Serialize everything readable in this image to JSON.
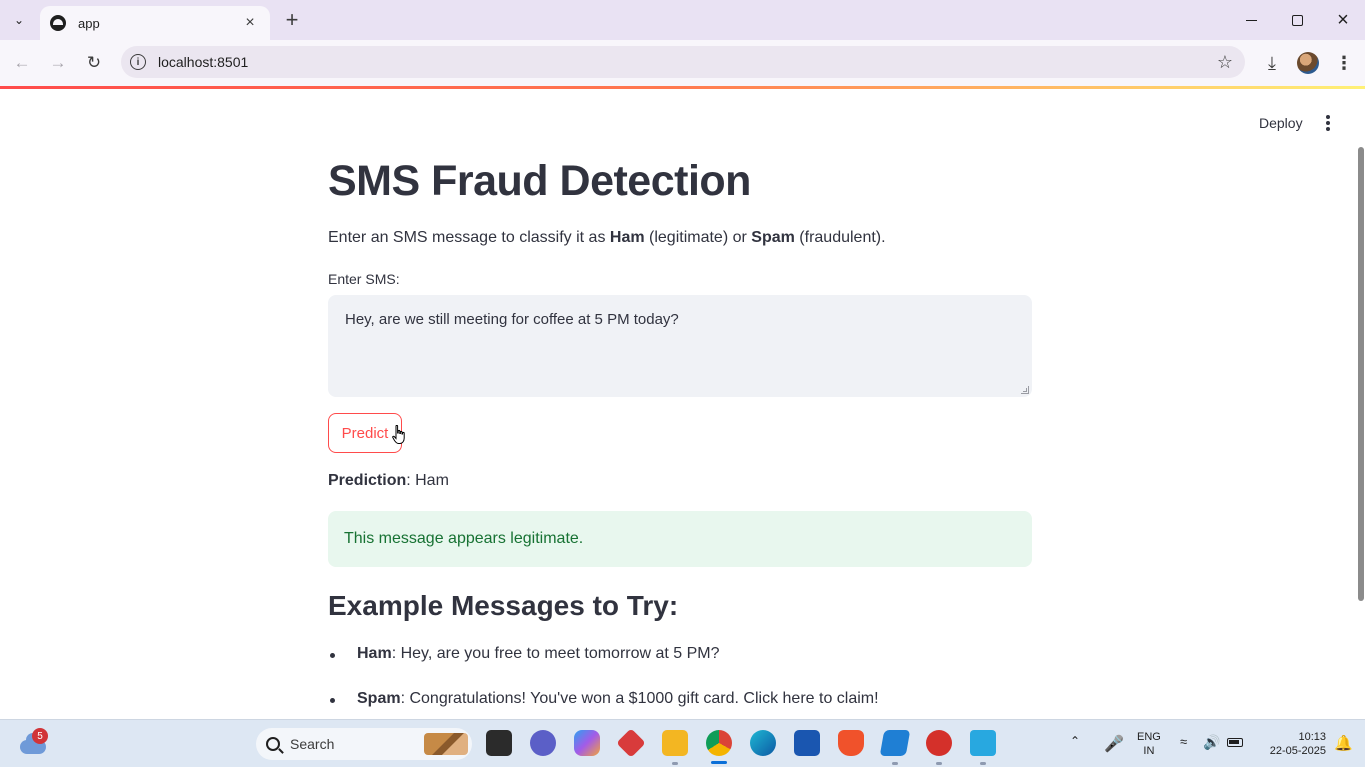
{
  "browser": {
    "tab_title": "app",
    "url": "localhost:8501"
  },
  "app": {
    "deploy_label": "Deploy",
    "title": "SMS Fraud Detection",
    "intro": {
      "part1": "Enter an SMS message to classify it as ",
      "ham": "Ham",
      "part2": " (legitimate) or ",
      "spam": "Spam",
      "part3": " (fraudulent)."
    },
    "input_label": "Enter SMS:",
    "input_value": "Hey, are we still meeting for coffee at 5 PM today?",
    "predict_label": "Predict",
    "prediction": {
      "label": "Prediction",
      "value": ": Ham"
    },
    "result_message": "This message appears legitimate.",
    "examples_heading": "Example Messages to Try:",
    "examples": [
      {
        "label": "Ham",
        "text": ": Hey, are you free to meet tomorrow at 5 PM?"
      },
      {
        "label": "Spam",
        "text": ": Congratulations! You've won a $1000 gift card. Click here to claim!"
      }
    ]
  },
  "taskbar": {
    "weather_badge": "5",
    "search_label": "Search",
    "lang_line1": "ENG",
    "lang_line2": "IN",
    "time": "10:13",
    "date": "22-05-2025"
  },
  "colors": {
    "accent": "#ff4b4b",
    "success_bg": "#e8f7ee",
    "success_text": "#177233",
    "text": "#31333f"
  }
}
